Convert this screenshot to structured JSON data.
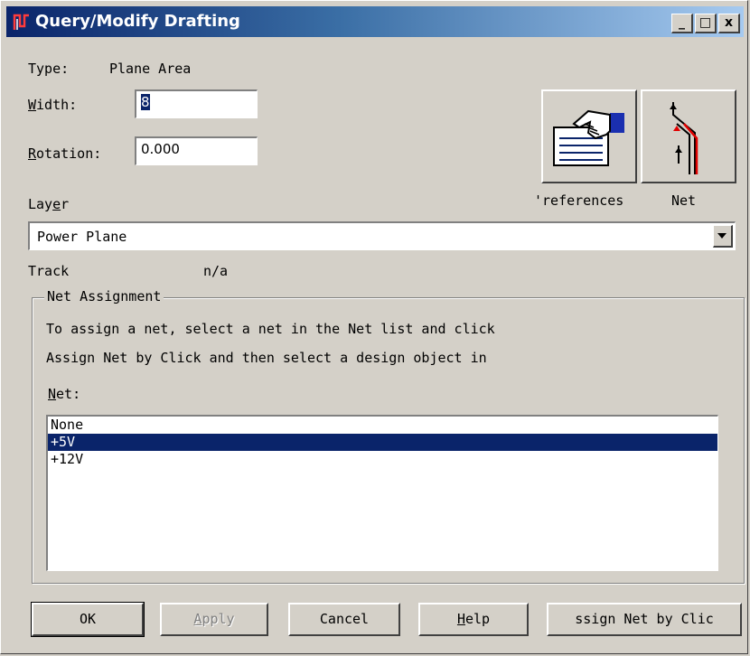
{
  "window": {
    "title": "Query/Modify Drafting",
    "controls": {
      "minimize": "_",
      "maximize": "□",
      "close": "x"
    }
  },
  "type_row": {
    "label": "Type:",
    "value": "Plane Area"
  },
  "width": {
    "label_first": "W",
    "label_rest": "idth:",
    "value": "8"
  },
  "rotation": {
    "label_first": "R",
    "label_rest": "otation:",
    "value": "0.000"
  },
  "icons": {
    "preferences_label": "'references",
    "net_label": "Net"
  },
  "layer": {
    "label_pre": "Lay",
    "label_u": "e",
    "label_post": "r",
    "selected": "Power Plane"
  },
  "track": {
    "label": "Track",
    "value": "n/a"
  },
  "net_assignment": {
    "title": "Net Assignment",
    "instructions_line1": "To assign a net, select a net in the Net list and click",
    "instructions_line2": "Assign Net by Click and then select a design object in",
    "net_label_first": "N",
    "net_label_rest": "et:",
    "items": [
      "None",
      "+5V",
      "+12V"
    ],
    "selected_index": 1
  },
  "buttons": {
    "ok": "OK",
    "apply_first": "A",
    "apply_rest": "pply",
    "cancel": "Cancel",
    "help_first": "H",
    "help_rest": "elp",
    "assign": "ssign Net by Clic"
  },
  "colors": {
    "selection": "#0a246a",
    "title_gradient_start": "#0a246a",
    "title_gradient_end": "#a6caf0",
    "face": "#d4d0c8"
  }
}
